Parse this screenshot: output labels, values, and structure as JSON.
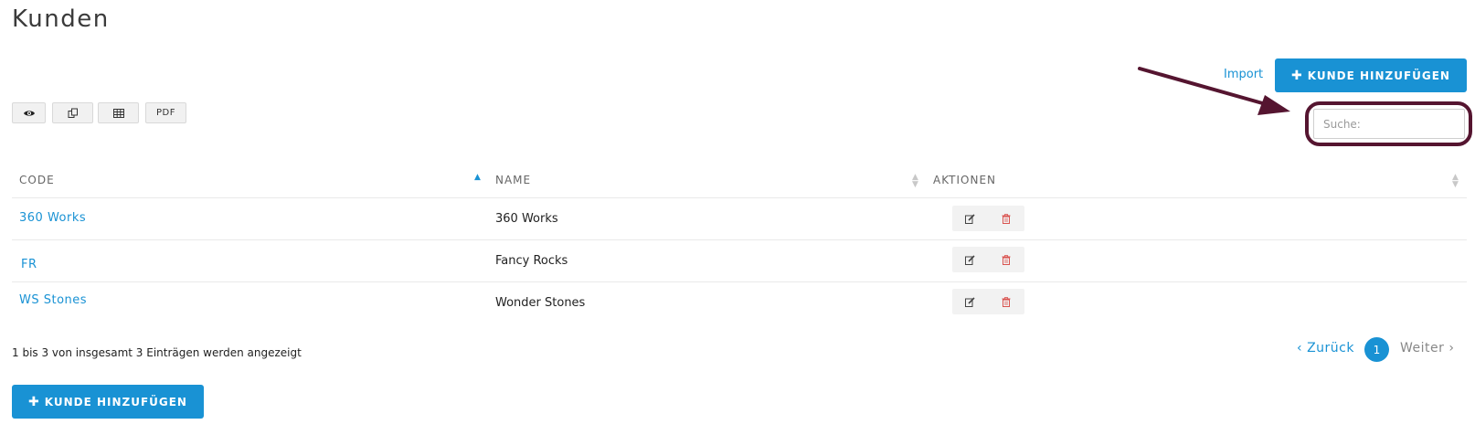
{
  "page": {
    "title": "Kunden"
  },
  "header": {
    "import_label": "Import",
    "add_button_label": "KUNDE HINZUFÜGEN",
    "add_button_icon": "plus-icon"
  },
  "toolbar": {
    "buttons": [
      {
        "icon": "eye-icon"
      },
      {
        "icon": "copy-icon"
      },
      {
        "icon": "table-icon"
      },
      {
        "label": "PDF"
      }
    ]
  },
  "search": {
    "placeholder": "Suche:",
    "value": ""
  },
  "table": {
    "columns": [
      {
        "label": "CODE",
        "sort": "ascending"
      },
      {
        "label": "NAME",
        "sort": "none"
      },
      {
        "label": "AKTIONEN",
        "sort": "none"
      }
    ],
    "rows": [
      {
        "code": "360 Works",
        "name": "360 Works"
      },
      {
        "code": "FR",
        "name": "Fancy Rocks"
      },
      {
        "code": "WS Stones",
        "name": "Wonder Stones"
      }
    ],
    "row_actions": [
      "edit-icon",
      "trash-icon"
    ]
  },
  "footer": {
    "info": "1 bis 3 von insgesamt 3 Einträgen werden angezeigt",
    "prev_label": "Zurück",
    "next_label": "Weiter",
    "current_page": "1",
    "add_button_label": "KUNDE HINZUFÜGEN"
  },
  "colors": {
    "accent": "#1992d4",
    "annotation": "#551530",
    "delete": "#d9534f"
  }
}
